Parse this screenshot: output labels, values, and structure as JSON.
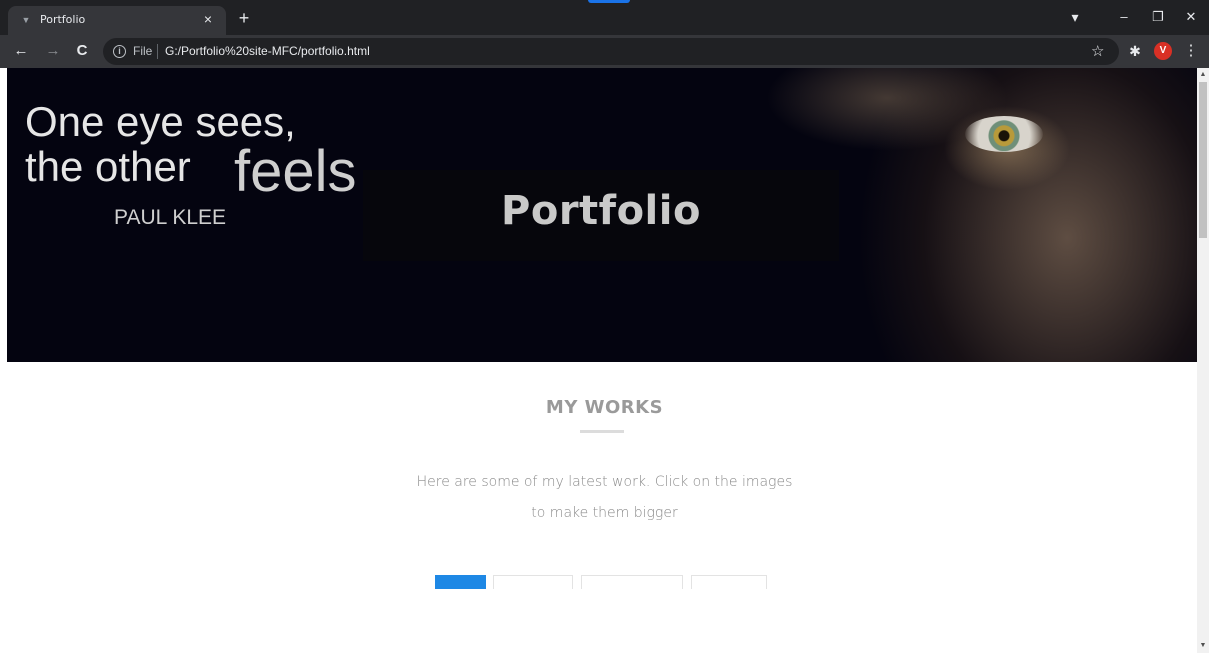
{
  "browser": {
    "tab_title": "Portfolio",
    "tab_close": "×",
    "new_tab": "+",
    "tab_favicon": "▼",
    "controls": {
      "search_tabs": "▾",
      "minimize": "–",
      "restore": "❐",
      "close": "✕"
    },
    "nav": {
      "back": "←",
      "forward": "→",
      "reload": "C"
    },
    "omnibox": {
      "info": "i",
      "label": "File",
      "url": "G:/Portfolio%20site-MFC/portfolio.html"
    },
    "star": "☆",
    "extensions": "✱",
    "profile_initial": "V",
    "menu": "⋮"
  },
  "hero": {
    "quote_line1": "One eye sees,",
    "quote_line2a": "the other",
    "quote_line2b": "feels",
    "quote_author": "PAUL KLEE",
    "title": "Portfolio"
  },
  "works": {
    "title": "MY WORKS",
    "description_line1": "Here are some of my latest work. Click on the images",
    "description_line2": "to make them bigger"
  },
  "scrollbar": {
    "up": "▲",
    "down": "▼"
  },
  "colors": {
    "accent": "#1e88e5",
    "chrome_dark": "#202124",
    "chrome_toolbar": "#35363a",
    "profile": "#d93025"
  }
}
